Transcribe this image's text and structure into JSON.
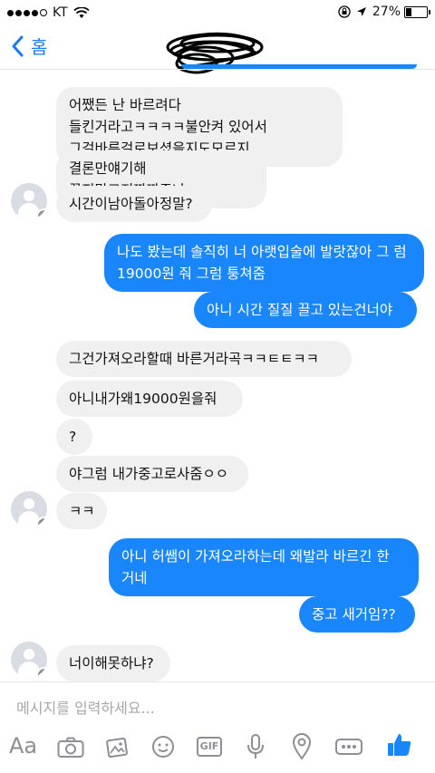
{
  "status_bar": {
    "carrier": "KT",
    "battery_percent": "27%",
    "battery_level": 0.27
  },
  "nav": {
    "back_label": "홈"
  },
  "messages": [
    {
      "dir": "in",
      "text": "어쨌든 난 바르려다 들킨거라고ㅋㅋㅋㅋ불안켜 있어서 그걸바른걸로보셨을지도모르지"
    },
    {
      "dir": "in",
      "text": "결론만얘기해 끌지말고진짜짜증나"
    },
    {
      "dir": "in",
      "text": "시간이남아돌아정말?"
    },
    {
      "dir": "out",
      "text": "나도 봤는데 솔직히 너 아랫입술에 발랏잖아 그 럼 19000원 줘 그럼 퉁쳐줌"
    },
    {
      "dir": "out",
      "text": "아니 시간 질질 끌고 있는건너야"
    },
    {
      "dir": "in",
      "text": "그건가져오라할때 바른거라곡ㅋㅋㅌㅌㅋㅋ"
    },
    {
      "dir": "in",
      "text": "아니내가왜19000원을줘"
    },
    {
      "dir": "in",
      "text": "?"
    },
    {
      "dir": "in",
      "text": "야그럼 내가중고로사줌ㅇㅇ"
    },
    {
      "dir": "in",
      "text": "ㅋㅋ"
    },
    {
      "dir": "out",
      "text": "아니 허쌤이 가져오라하는데 왜발라 바르긴 한 거네"
    },
    {
      "dir": "out",
      "text": "중고 새거임??"
    },
    {
      "dir": "in",
      "text": "너이해못하냐?"
    }
  ],
  "composer": {
    "placeholder": "메시지를 입력하세요...",
    "aa_label": "Aa",
    "gif_label": "GIF"
  },
  "icons": [
    "back-chevron-icon",
    "camera-icon",
    "gallery-icon",
    "sticker-icon",
    "gif-icon",
    "microphone-icon",
    "location-icon",
    "more-icon",
    "like-icon",
    "facebook-badge-icon"
  ],
  "colors": {
    "accent": "#1a86fb",
    "incoming_bubble": "#f0f0f0",
    "icon_gray": "#8e8e93"
  }
}
